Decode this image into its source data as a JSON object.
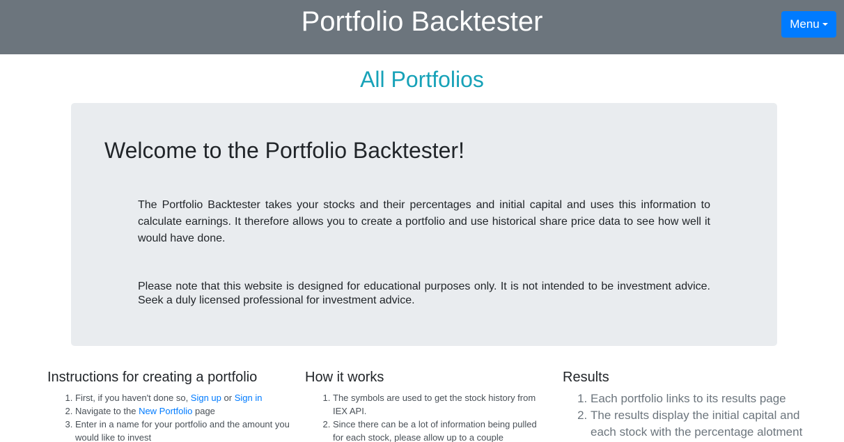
{
  "header": {
    "title": "Portfolio Backtester",
    "menu_label": "Menu"
  },
  "page_heading": "All Portfolios",
  "jumbotron": {
    "title": "Welcome to the Portfolio Backtester!",
    "paragraph1": "The Portfolio Backtester takes your stocks and their percentages and initial capital and uses this information to calculate earnings. It therefore allows you to create a portfolio and use historical share price data to see how well it would have done.",
    "paragraph2": "Please note that this website is designed for educational purposes only. It is not intended to be investment advice. Seek a duly licensed professional for investment advice."
  },
  "instructions": {
    "title": "Instructions for creating a portfolio",
    "step1_prefix": "First, if you haven't done so, ",
    "signup_link": "Sign up",
    "or_text": " or ",
    "signin_link": "Sign in",
    "step2_prefix": "Navigate to the ",
    "new_portfolio_link": "New Portfolio",
    "step2_suffix": " page",
    "step3": "Enter in a name for your portfolio and the amount you would like to invest"
  },
  "how_it_works": {
    "title": "How it works",
    "items": [
      "The symbols are used to get the stock history from IEX API.",
      "Since there can be a lot of information being pulled for each stock, please allow up to a couple"
    ]
  },
  "results": {
    "title": "Results",
    "items": [
      "Each portfolio links to its results page",
      "The results display the initial capital and each stock with the percentage alotment"
    ]
  }
}
